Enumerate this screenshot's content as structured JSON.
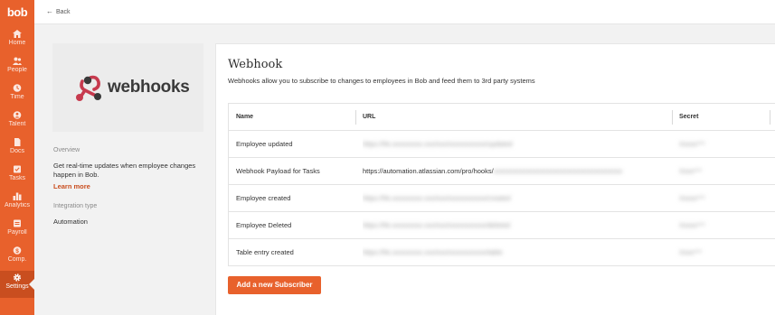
{
  "app": {
    "logo": "bob"
  },
  "sidebar": {
    "items": [
      {
        "label": "Home",
        "icon": "home-icon"
      },
      {
        "label": "People",
        "icon": "people-icon"
      },
      {
        "label": "Time",
        "icon": "clock-icon"
      },
      {
        "label": "Talent",
        "icon": "talent-icon"
      },
      {
        "label": "Docs",
        "icon": "docs-icon"
      },
      {
        "label": "Tasks",
        "icon": "tasks-icon"
      },
      {
        "label": "Analytics",
        "icon": "analytics-icon"
      },
      {
        "label": "Payroll",
        "icon": "payroll-icon"
      },
      {
        "label": "Comp.",
        "icon": "compensation-icon"
      },
      {
        "label": "Settings",
        "icon": "gear-icon",
        "active": true
      }
    ],
    "accent": "#e8612c"
  },
  "topbar": {
    "back_label": "Back"
  },
  "integration": {
    "hero_text": "webhooks",
    "overview_label": "Overview",
    "overview_text": "Get real-time updates when employee changes happen in Bob.",
    "learn_more": "Learn more",
    "type_label": "Integration type",
    "type_value": "Automation"
  },
  "main": {
    "title": "Webhook",
    "description": "Webhooks allow you to subscribe to changes to employees in Bob and feed them to 3rd party systems",
    "table": {
      "columns": [
        "Name",
        "URL",
        "Secret"
      ],
      "rows": [
        {
          "name": "Employee updated",
          "url_visible": "",
          "url_hidden": "https://hk.xxxxxxxxx.xxx/xxx/xxxxxxxxxxx/updated",
          "secret": "Xxxxx***"
        },
        {
          "name": "Webhook Payload for Tasks",
          "url_visible": "https://automation.atlassian.com/pro/hooks/",
          "url_hidden": "xxxxxxxxxxxxxxxxxxxxxxxxxxxxxxxxxxxxxx",
          "secret": "Xxxx***"
        },
        {
          "name": "Employee created",
          "url_visible": "",
          "url_hidden": "https://hk.xxxxxxxxx.xxx/xxx/xxxxxxxxxxx/created",
          "secret": "Xxxxx***"
        },
        {
          "name": "Employee Deleted",
          "url_visible": "",
          "url_hidden": "https://hk.xxxxxxxxx.xxx/xxx/xxxxxxxxxxx/deleted",
          "secret": "Xxxxx***"
        },
        {
          "name": "Table entry created",
          "url_visible": "",
          "url_hidden": "https://hk.xxxxxxxxx.xxx/xxx/xxxxxxxxxxx/table",
          "secret": "Xxxx***"
        }
      ]
    },
    "add_button": "Add a new Subscriber"
  }
}
